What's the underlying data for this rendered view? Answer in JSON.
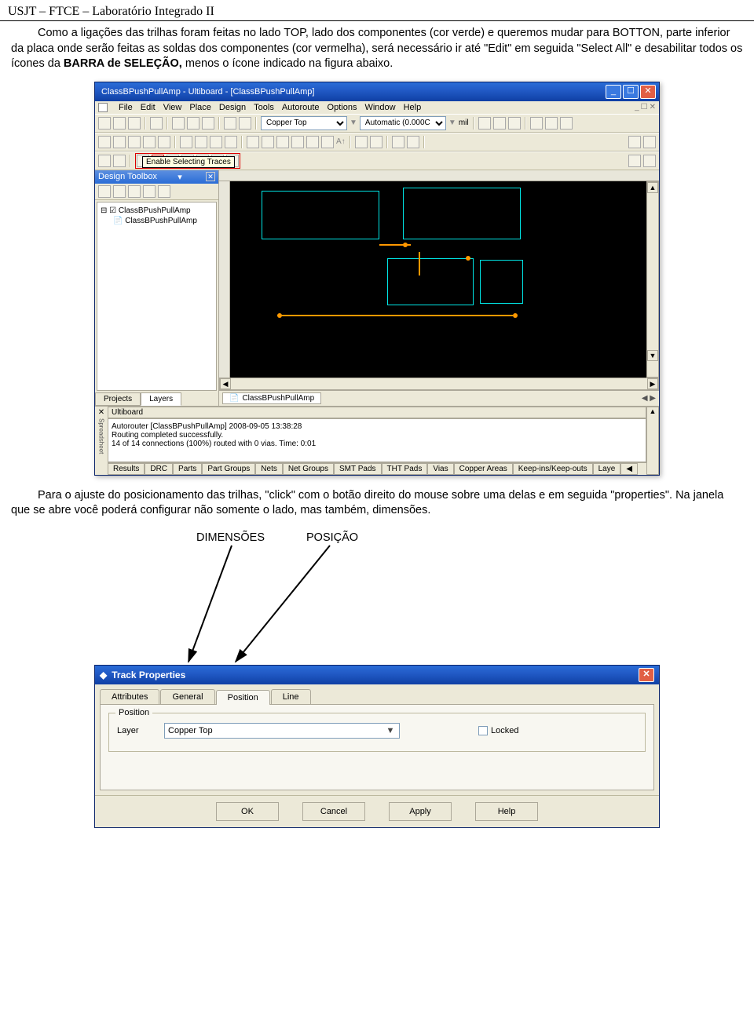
{
  "header": "USJT – FTCE – Laboratório Integrado II",
  "para1_pre": "Como a ligações das trilhas foram feitas no lado TOP, lado dos componentes (cor verde) e queremos mudar para BOTTON, parte inferior da placa onde serão feitas as soldas dos componentes (cor vermelha), será necessário ir até \"Edit\" em seguida \"Select All\" e desabilitar todos os ícones da ",
  "para1_bold": "BARRA de SELEÇÃO, ",
  "para1_post": "menos o ícone indicado na figura abaixo.",
  "ultiboard": {
    "title": "ClassBPushPullAmp - Ultiboard - [ClassBPushPullAmp]",
    "menus": [
      "File",
      "Edit",
      "View",
      "Place",
      "Design",
      "Tools",
      "Autoroute",
      "Options",
      "Window",
      "Help"
    ],
    "layer_combo": "Copper Top",
    "units_combo": "Automatic (0.000C",
    "units_label": "mil",
    "tooltip": "Enable Selecting Traces",
    "sidebar_title": "Design Toolbox",
    "tree_root": "ClassBPushPullAmp",
    "tree_child": "ClassBPushPullAmp",
    "sidebar_tabs": [
      "Projects",
      "Layers"
    ],
    "doc_tab": "ClassBPushPullAmp",
    "ss_title": "Ultiboard",
    "ss_lines": [
      "Autorouter [ClassBPushPullAmp]  2008-09-05 13:38:28",
      "Routing completed successfully.",
      "14 of 14 connections (100%) routed with 0 vias.  Time: 0:01"
    ],
    "ss_tabs": [
      "Results",
      "DRC",
      "Parts",
      "Part Groups",
      "Nets",
      "Net Groups",
      "SMT Pads",
      "THT Pads",
      "Vias",
      "Copper Areas",
      "Keep-ins/Keep-outs",
      "Laye"
    ]
  },
  "para2": "Para o ajuste do posicionamento das trilhas, \"click\" com o botão direito do mouse sobre uma delas e em seguida \"properties\". Na janela que se abre você poderá configurar não somente o lado, mas também, dimensões.",
  "anno_left": "DIMENSÕES",
  "anno_right": "POSIÇÃO",
  "tp": {
    "title": "Track Properties",
    "tabs": [
      "Attributes",
      "General",
      "Position",
      "Line"
    ],
    "active_tab": 2,
    "group_legend": "Position",
    "layer_label": "Layer",
    "layer_value": "Copper Top",
    "locked_label": "Locked",
    "buttons": [
      "OK",
      "Cancel",
      "Apply",
      "Help"
    ]
  }
}
